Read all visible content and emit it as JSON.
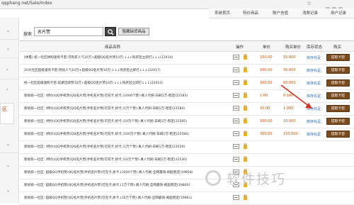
{
  "browser": {
    "url": "qqphang.net/Sale/Index"
  },
  "topnav": [
    "系统首页",
    "特价商品",
    "账户充值",
    "消费记录",
    "用户记录"
  ],
  "search": {
    "label": "搜索",
    "value": "名片赞",
    "filter_label": "隐藏缺货商品"
  },
  "table": {
    "headers": [
      "商品名称",
      "操作",
      "单价",
      "购买单价",
      "库存状态",
      "购买"
    ],
    "rows": [
      {
        "name": "(拼量) 统一社区拼购速购卡密-可购买人气10万+超级QQ名片赞10万-↓↓↓购买后立即打↓↓↓(21914)",
        "price": "100.00",
        "buyprice": "55.000",
        "status": "库存充足",
        "buy": "提取卡密"
      },
      {
        "name": "20大社区超级速购卡密-持续人气10万+超级QQ名片赞10万-↓↓↓购买后立即打↓↓↓(22017)",
        "price": "100.00",
        "buyprice": "55.000",
        "status": "库存充足",
        "buy": "提取卡密"
      },
      {
        "name": "统一社区超级速购卡密-前期活跃赞10万+超级QQ名片赞10万-↓↓↓购买后立即打↓↓↓(22014)",
        "price": "100.00",
        "buyprice": "60.000",
        "status": "库存充足",
        "buy": "提取卡密"
      },
      {
        "name": "新统统一社区: (特价)QQ手机赞(QQ名片赞|手机名片赞)可充卡,拆卡,(1000个赞)-真人代刷-日刷1万-稳定(22583)",
        "price": "1.00",
        "buyprice": "0.100",
        "status": "库存充足",
        "buy": "提取卡密"
      },
      {
        "name": "新统统一社区: (特价)QQ手机赞(QQ名片赞|手机名片赞)可充卡,拆卡,(1万个赞)-真人代刷-日刷1万-稳定(22584)",
        "price": "10.00",
        "buyprice": "1.000",
        "status": "库存充足",
        "buy": "提取卡密"
      },
      {
        "name": "新统统一社区: (特价)QQ手机赞(QQ名片赞|手机名片赞)可充卡,拆卡,(10万个赞)-真人代刷-日刷1万-稳定(22585)",
        "price": "100.00",
        "buyprice": "10.000",
        "status": "库存充足",
        "buy": "提取卡密"
      },
      {
        "name": "新统统一社区: (特价)QQ手机赞(QQ名片赞|手机名片赞)可充卡,拆卡,(100万个赞)-真人代刷-日刷1万-稳定(22586)",
        "price": "300.00",
        "buyprice": "150.000",
        "status": "库存充足",
        "buy": "提取卡密"
      },
      {
        "name": "新统统一社区: (特价)QQ手机赞(QQ名片赞|手机名片赞)可充卡,拆卡,(1万个赞)-真人代刷-日刷1万-稳定(22529)",
        "price": "",
        "buyprice": "",
        "status": "",
        "buy": ""
      },
      {
        "name": "新统统一社区: (特价)QQ手机赞(QQ名片赞|手机名片赞)可充卡,拆卡,(10万个赞)-真人代刷-日刷1万-稳定(22530)",
        "price": "",
        "buyprice": "",
        "status": "",
        "buy": ""
      },
      {
        "name": "新统统一社区: 超级QQ手机赞(QQ名片赞|手机名片赞)可充卡,拆卡,(1000个赞)-真人代刷-全网最快-刷超稳定(19858)",
        "price": "",
        "buyprice": "",
        "status": "",
        "buy": ""
      },
      {
        "name": "新统统一社区: 超级QQ手机赞(QQ名片赞|手机名片赞)可充卡,拆卡,(1万个赞)-真人代刷-全网最快-刷超稳定(19860)",
        "price": "",
        "buyprice": "",
        "status": "",
        "buy": ""
      },
      {
        "name": "新统统一社区: 超级QQ手机赞(QQ名片赞|手机名片赞)可充卡,拆卡,(10万个赞)-真人代刷-全网最快-刷超稳定(19861)",
        "price": "",
        "buyprice": "",
        "status": "",
        "buy": ""
      }
    ]
  },
  "sidebar": {
    "bubble_text": "区"
  },
  "watermark": {
    "text": "软件技巧"
  },
  "colors": {
    "buy_button": "#7a4b1f",
    "price": "#cc5500",
    "status": "#2a6dc4",
    "arrow": "#d83020"
  }
}
